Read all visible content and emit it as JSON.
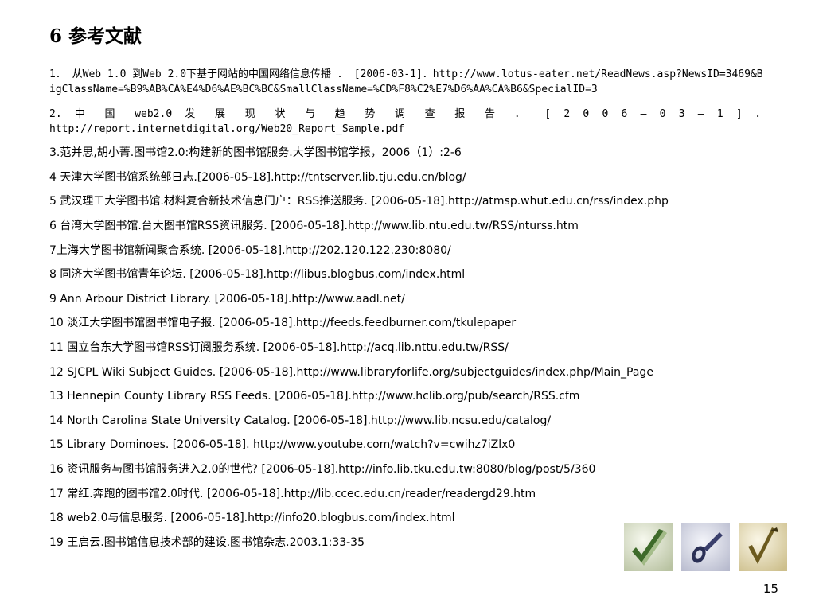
{
  "slide": {
    "title": "6 参考文献",
    "page_number": "15"
  },
  "references": [
    "1． 从Web 1.0 到Web 2.0下基于网站的中国网络信息传播 ． [2006-03-1]．http://www.lotus-eater.net/ReadNews.asp?NewsID=3469&BigClassName=%B9%AB%CA%E4%D6%AE%BC%BC&SmallClassName=%CD%F8%C2%E7%D6%AA%CA%B6&SpecialID=3",
    "2. 中 国 web2.0 发 展 现 状 与 趋 势 调 查 报 告 ． [ 2 0 0 6 – 0 3 – 1 ] ．",
    "http://report.internetdigital.org/Web20_Report_Sample.pdf",
    "3.范并思,胡小菁.图书馆2.0:构建新的图书馆服务.大学图书馆学报，2006（1）:2-6",
    "4 天津大学图书馆系统部日志.[2006-05-18].http://tntserver.lib.tju.edu.cn/blog/",
    "5 武汉理工大学图书馆.材料复合新技术信息门户：RSS推送服务. [2006-05-18].http://atmsp.whut.edu.cn/rss/index.php",
    "6 台湾大学图书馆.台大图书馆RSS资讯服务. [2006-05-18].http://www.lib.ntu.edu.tw/RSS/nturss.htm",
    "7上海大学图书馆新闻聚合系统. [2006-05-18].http://202.120.122.230:8080/",
    "8 同济大学图书馆青年论坛. [2006-05-18].http://libus.blogbus.com/index.html",
    "9 Ann Arbour District Library. [2006-05-18].http://www.aadl.net/",
    "10 淡江大学图书馆图书馆电子报. [2006-05-18].http://feeds.feedburner.com/tkulepaper",
    "11 国立台东大学图书馆RSS订阅服务系统. [2006-05-18].http://acq.lib.nttu.edu.tw/RSS/",
    "12 SJCPL Wiki Subject Guides. [2006-05-18].http://www.libraryforlife.org/subjectguides/index.php/Main_Page",
    "13 Hennepin County Library RSS Feeds. [2006-05-18].http://www.hclib.org/pub/search/RSS.cfm",
    "14 North Carolina State University Catalog. [2006-05-18].http://www.lib.ncsu.edu/catalog/",
    "15 Library Dominoes. [2006-05-18]. http://www.youtube.com/watch?v=cwihz7iZlx0",
    "16 资讯服务与图书馆服务进入2.0的世代? [2006-05-18].http://info.lib.tku.edu.tw:8080/blog/post/5/360",
    "17 常红.奔跑的图书馆2.0时代. [2006-05-18].http://lib.ccec.edu.cn/reader/readergd29.htm",
    "18 web2.0与信息服务. [2006-05-18].http://info20.blogbus.com/index.html",
    "19 王启云.图书馆信息技术部的建设.图书馆杂志.2003.1:33-35"
  ],
  "decor": {
    "thumb1_colors": [
      "#e9eedc",
      "#3e6a2a"
    ],
    "thumb2_colors": [
      "#e4e6ef",
      "#2a2f55"
    ],
    "thumb3_colors": [
      "#f1ecd6",
      "#6b5a1e"
    ]
  }
}
